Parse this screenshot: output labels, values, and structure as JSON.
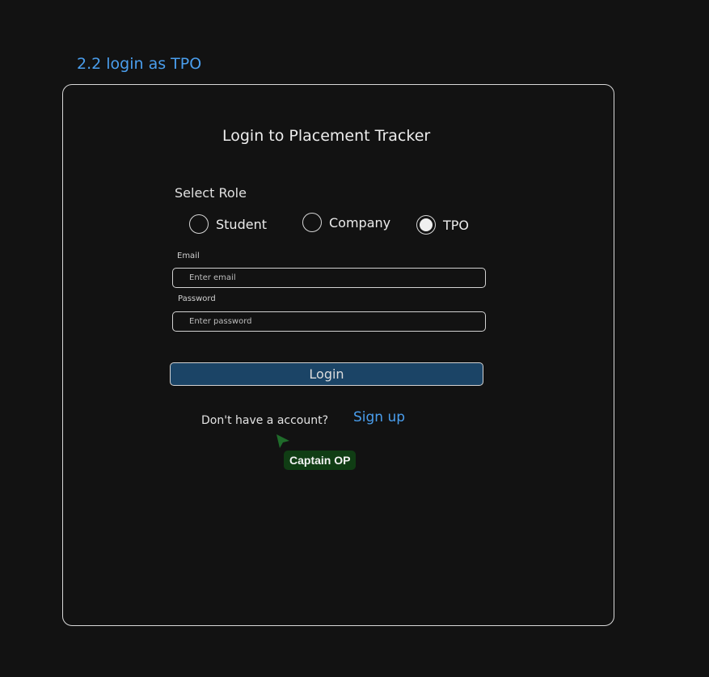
{
  "frame": {
    "label": "2.2 login as TPO"
  },
  "login": {
    "title": "Login to Placement Tracker",
    "role_label": "Select Role",
    "roles": [
      {
        "label": "Student",
        "selected": false
      },
      {
        "label": "Company",
        "selected": false
      },
      {
        "label": "TPO",
        "selected": true
      }
    ],
    "email": {
      "label": "Email",
      "value": "",
      "placeholder": "Enter email"
    },
    "password": {
      "label": "Password",
      "value": "",
      "placeholder": "Enter password"
    },
    "login_button": "Login",
    "no_account_text": "Don't have a account?",
    "signup_link": "Sign up"
  },
  "collaborator": {
    "name": "Captain OP",
    "color": "#103d14"
  },
  "colors": {
    "background": "#121212",
    "accent": "#4a9eed",
    "button_fill": "#1b4466"
  }
}
